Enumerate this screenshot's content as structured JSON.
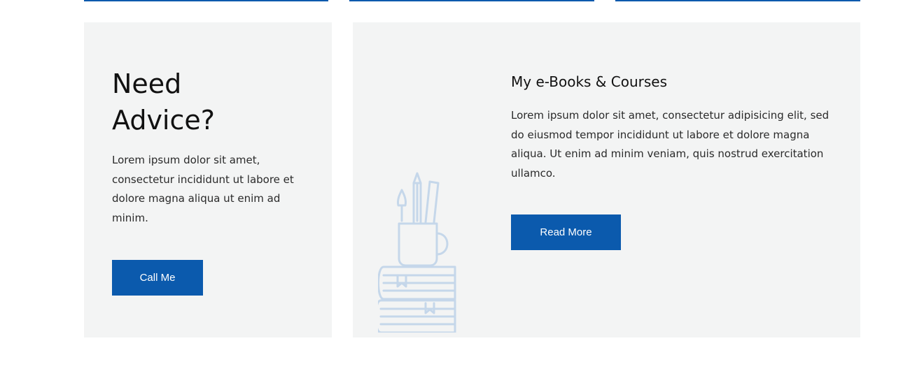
{
  "advice": {
    "title_line1": "Need",
    "title_line2": "Advice?",
    "text": "Lorem ipsum dolor sit amet, consectetur incididunt ut labore et dolore magna aliqua ut enim ad minim.",
    "button_label": "Call Me"
  },
  "ebooks": {
    "title": "My e-Books & Courses",
    "text": "Lorem ipsum dolor sit amet, consectetur adipisicing elit, sed do eiusmod tempor incididunt ut labore et dolore magna aliqua. Ut enim ad minim veniam, quis nostrud exercitation ullamco.",
    "button_label": "Read More",
    "illustration_icon": "books-and-pencil-cup-icon"
  },
  "colors": {
    "accent": "#0b5aad",
    "card_background": "#f3f4f4",
    "illustration_stroke": "#c5d7ea"
  }
}
